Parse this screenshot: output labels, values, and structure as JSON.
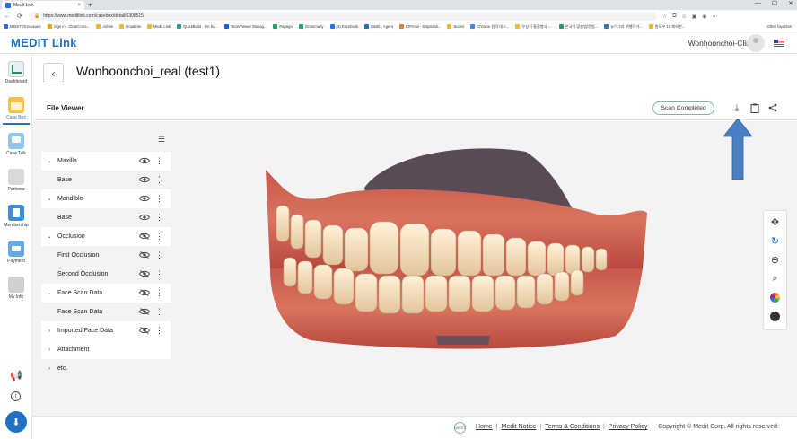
{
  "browser": {
    "tab_title": "Medit Link",
    "url": "https://www.meditlink.com/casebox/detail/6308515",
    "bookmarks": [
      "MEDIT Groupware",
      "Sign in - ClearCorre...",
      "Admin",
      "Roadmin",
      "Medit Link",
      "QuickBuild - the bu...",
      "TeamViewer Manag...",
      "Papago",
      "Grammarly",
      "(3) Facebook",
      "Medit - Agent",
      "IOPmail - Disposab...",
      "Suomi",
      "Chrome 원격 데스...",
      "우성치 통합봉사 -...",
      "한국어 맞춤법/문법...",
      "뉴이그라 여행작가...",
      "원도우 10 해외판..."
    ],
    "other_favorites": "Other favorites"
  },
  "header": {
    "logo": "MEDIT Link",
    "user": "Wonhoonchoi-Clinic"
  },
  "nav": {
    "dashboard": "Dashboard",
    "case_box": "Case Box",
    "case_talk": "Case Talk",
    "partners": "Partners",
    "membership": "Membership",
    "payment": "Payment",
    "my_info": "My Info"
  },
  "case": {
    "title": "Wonhoonchoi_real (test1)"
  },
  "viewer": {
    "label": "File Viewer",
    "status": "Scan Completed"
  },
  "tree": [
    {
      "label": "Maxilla",
      "type": "group",
      "expanded": true,
      "visible": true
    },
    {
      "label": "Base",
      "type": "child",
      "visible": true
    },
    {
      "label": "Mandible",
      "type": "group",
      "expanded": true,
      "visible": true
    },
    {
      "label": "Base",
      "type": "child",
      "visible": true
    },
    {
      "label": "Occlusion",
      "type": "group",
      "expanded": true,
      "visible": false
    },
    {
      "label": "First Occlusion",
      "type": "child",
      "visible": false
    },
    {
      "label": "Second Occlusion",
      "type": "child",
      "visible": false
    },
    {
      "label": "Face Scan Data",
      "type": "group",
      "expanded": true,
      "visible": false
    },
    {
      "label": "Face Scan Data",
      "type": "child",
      "visible": false
    },
    {
      "label": "Imported Face Data",
      "type": "group",
      "expanded": false,
      "visible": false
    },
    {
      "label": "Attachment",
      "type": "group",
      "expanded": false,
      "visible": null
    },
    {
      "label": "etc.",
      "type": "plain",
      "expanded": false,
      "visible": null
    }
  ],
  "footer": {
    "logo_text": "MEDIT",
    "links": [
      "Home",
      "Medit Notice",
      "Terms & Conditions",
      "Privacy Policy"
    ],
    "copyright": "Copyright © Medit Corp. All rights reserved."
  },
  "colors": {
    "brand": "#1f6fc5",
    "annotation_arrow": "#4a7fc4"
  }
}
